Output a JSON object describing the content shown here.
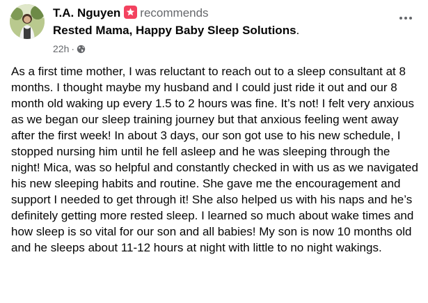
{
  "post": {
    "author": "T.A. Nguyen",
    "action": "recommends",
    "page_name": "Rested Mama, Happy Baby Sleep Solutions",
    "page_suffix": ".",
    "timestamp": "22h",
    "separator": "·",
    "audience_icon": "globe-icon",
    "recommend_icon": "recommend-star-icon",
    "more_icon": "more-options-icon",
    "body": "As a first time mother, I was reluctant to reach out to a sleep consultant at 8 months. I thought maybe my husband and I could just ride it out and our 8 month old waking up every 1.5 to 2 hours was fine. It’s not! I felt very anxious as we began our sleep training journey but that anxious feeling went away after the first week! In about 3 days, our son got use to his new schedule, I stopped nursing him until he fell asleep and he was sleeping through the night! Mica, was so helpful and constantly checked in with us as we navigated his new sleeping habits and routine. She gave me the encouragement and support I needed to get through it! She also helped us with his naps and he’s definitely getting more rested sleep. I learned so much about wake times and how sleep is so vital for our son and all babies! My son is now 10 months old and he sleeps about 11-12 hours at night with little to no night wakings."
  },
  "colors": {
    "text_primary": "#050505",
    "text_secondary": "#65676b",
    "recommend_badge": "#f3425f",
    "background": "#ffffff"
  }
}
